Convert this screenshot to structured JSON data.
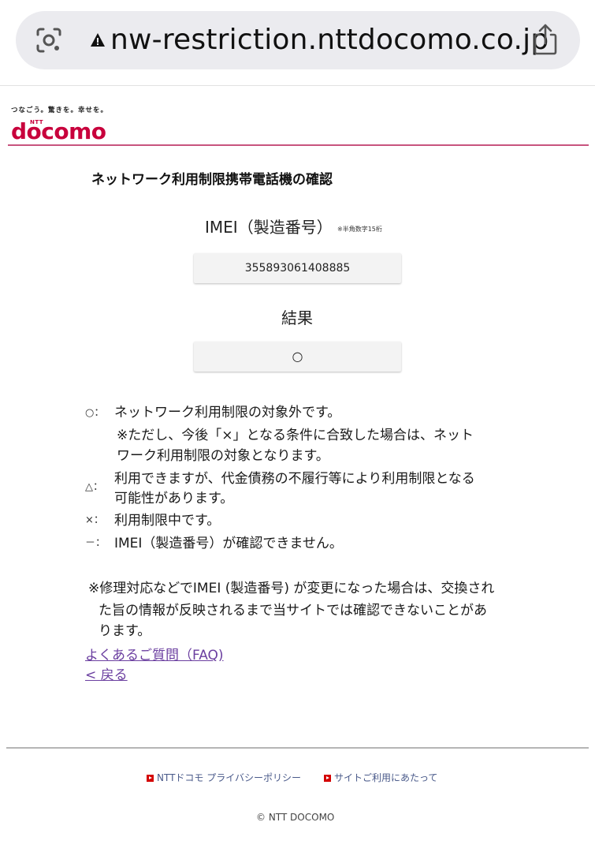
{
  "browser": {
    "url": "nw-restriction.nttdocomo.co.jp"
  },
  "header": {
    "tagline": "つなごう。驚きを。幸せを。",
    "logo_ntt": "NTT",
    "logo_word": "docomo",
    "accent_color": "#c8003c"
  },
  "page": {
    "title": "ネットワーク利用制限携帯電話機の確認",
    "imei_label": "IMEI（製造番号）",
    "imei_note": "※半角数字15桁",
    "imei_value": "355893061408885",
    "result_label": "結果",
    "result_value": "○"
  },
  "legend": {
    "circle_sym": "○：",
    "circle_text": "ネットワーク利用制限の対象外です。",
    "circle_note_1": "※ただし、今後「×」となる条件に合致した場合は、ネット",
    "circle_note_2": "ワーク利用制限の対象となります。",
    "triangle_sym": "△：",
    "triangle_text_1": "利用できますが、代金債務の不履行等により利用制限となる",
    "triangle_text_2": "可能性があります。",
    "cross_sym": "×：",
    "cross_text": "利用制限中です。",
    "dash_sym": "－：",
    "dash_text": "IMEI（製造番号）が確認できません。"
  },
  "note": {
    "line_1": "※修理対応などでIMEI (製造番号) が変更になった場合は、交換され",
    "line_2": "た旨の情報が反映されるまで当サイトでは確認できないことがあ",
    "line_3": "ります。"
  },
  "links": {
    "faq": "よくあるご質問（FAQ)",
    "back": "< 戻る"
  },
  "footer": {
    "privacy": "NTTドコモ プライバシーポリシー",
    "terms": "サイトご利用にあたって",
    "copyright": "© NTT DOCOMO"
  }
}
